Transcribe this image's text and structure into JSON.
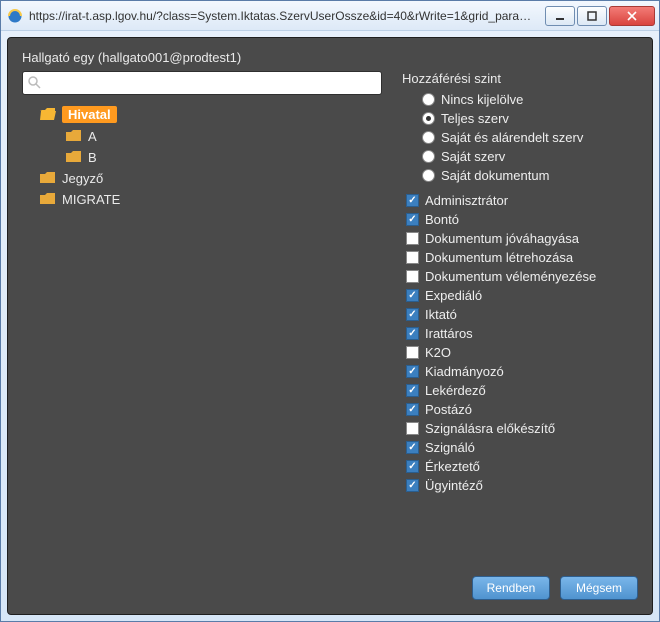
{
  "window": {
    "url": "https://irat-t.asp.lgov.hu/?class=System.Iktatas.SzervUserOssze&id=40&rWrite=1&grid_params..."
  },
  "user_label": "Hallgató egy (hallgato001@prodtest1)",
  "search": {
    "placeholder": ""
  },
  "tree": {
    "items": [
      {
        "label": "Hivatal",
        "level": 1,
        "open": true,
        "selected": true
      },
      {
        "label": "A",
        "level": 2,
        "open": false,
        "selected": false
      },
      {
        "label": "B",
        "level": 2,
        "open": false,
        "selected": false
      },
      {
        "label": "Jegyző",
        "level": 1,
        "open": false,
        "selected": false
      },
      {
        "label": "MIGRATE",
        "level": 1,
        "open": false,
        "selected": false
      }
    ]
  },
  "access": {
    "title": "Hozzáférési szint",
    "options": [
      {
        "label": "Nincs kijelölve",
        "checked": false
      },
      {
        "label": "Teljes szerv",
        "checked": true
      },
      {
        "label": "Saját és alárendelt szerv",
        "checked": false
      },
      {
        "label": "Saját szerv",
        "checked": false
      },
      {
        "label": "Saját dokumentum",
        "checked": false
      }
    ]
  },
  "roles": [
    {
      "label": "Adminisztrátor",
      "checked": true
    },
    {
      "label": "Bontó",
      "checked": true
    },
    {
      "label": "Dokumentum jóváhagyása",
      "checked": false
    },
    {
      "label": "Dokumentum létrehozása",
      "checked": false
    },
    {
      "label": "Dokumentum véleményezése",
      "checked": false
    },
    {
      "label": "Expediáló",
      "checked": true
    },
    {
      "label": "Iktató",
      "checked": true
    },
    {
      "label": "Irattáros",
      "checked": true
    },
    {
      "label": "K2O",
      "checked": false
    },
    {
      "label": "Kiadmányozó",
      "checked": true
    },
    {
      "label": "Lekérdező",
      "checked": true
    },
    {
      "label": "Postázó",
      "checked": true
    },
    {
      "label": "Szignálásra előkészítő",
      "checked": false
    },
    {
      "label": "Szignáló",
      "checked": true
    },
    {
      "label": "Érkeztető",
      "checked": true
    },
    {
      "label": "Ügyintéző",
      "checked": true
    }
  ],
  "buttons": {
    "ok": "Rendben",
    "cancel": "Mégsem"
  }
}
